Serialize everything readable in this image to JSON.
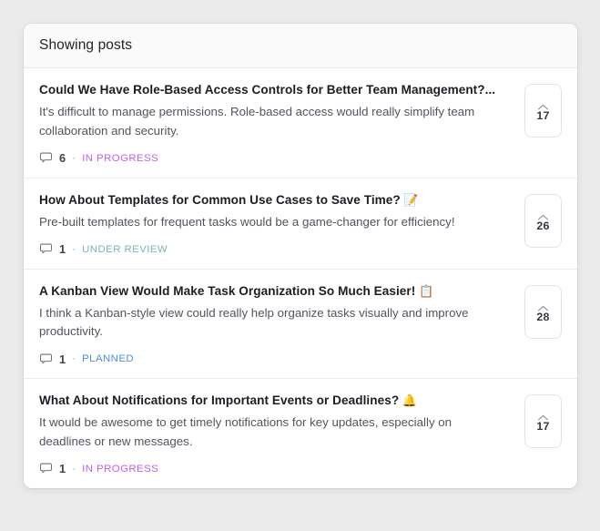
{
  "page": {
    "background_color": "#ebebeb"
  },
  "card": {
    "header": {
      "title": "Showing posts"
    }
  },
  "icons": {
    "comment": "comment-icon",
    "upvote": "chevron-up-icon"
  },
  "status_colors": {
    "IN PROGRESS": "#c45ef0",
    "UNDER REVIEW": "#7fb3b6",
    "PLANNED": "#4a90e2"
  },
  "posts": [
    {
      "title": "Could We Have Role-Based Access Controls for Better Team Management?...",
      "emoji": "",
      "body": "It's difficult to manage permissions. Role-based access would really simplify team collaboration and security.",
      "comments": "6",
      "separator": "·",
      "status": "IN PROGRESS",
      "status_color": "#c45ef0",
      "votes": "17"
    },
    {
      "title": "How About Templates for Common Use Cases to Save Time?",
      "emoji": "📝",
      "body": "Pre-built templates for frequent tasks would be a game-changer for efficiency!",
      "comments": "1",
      "separator": "·",
      "status": "UNDER REVIEW",
      "status_color": "#7fb3b6",
      "votes": "26"
    },
    {
      "title": "A Kanban View Would Make Task Organization So Much Easier!",
      "emoji": "📋",
      "body": "I think a Kanban-style view could really help organize tasks visually and improve productivity.",
      "comments": "1",
      "separator": "·",
      "status": "PLANNED",
      "status_color": "#4a90e2",
      "votes": "28"
    },
    {
      "title": "What About Notifications for Important Events or Deadlines?",
      "emoji": "🔔",
      "body": "It would be awesome to get timely notifications for key updates, especially on deadlines or new messages.",
      "comments": "1",
      "separator": "·",
      "status": "IN PROGRESS",
      "status_color": "#c45ef0",
      "votes": "17"
    }
  ]
}
